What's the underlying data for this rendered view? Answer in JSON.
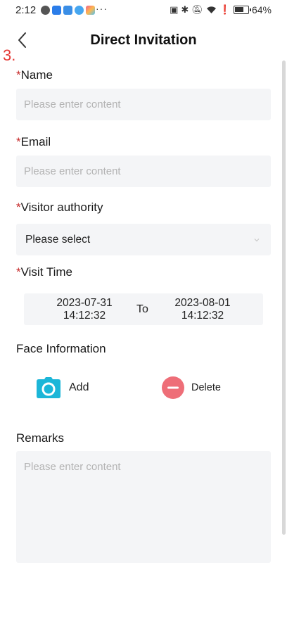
{
  "status_bar": {
    "time": "2:12",
    "more": "···",
    "battery_level": "64%"
  },
  "header": {
    "title": "Direct Invitation",
    "step_mark": "3."
  },
  "form": {
    "required_marker": "*",
    "name": {
      "label": "Name",
      "placeholder": "Please enter content"
    },
    "email": {
      "label": "Email",
      "placeholder": "Please enter content"
    },
    "visitor_authority": {
      "label": "Visitor authority",
      "value": "Please select"
    },
    "visit_time": {
      "label": "Visit Time",
      "start_date": "2023-07-31",
      "start_time": "14:12:32",
      "separator": "To",
      "end_date": "2023-08-01",
      "end_time": "14:12:32"
    },
    "face_information": {
      "label": "Face Information",
      "add_label": "Add",
      "delete_label": "Delete"
    },
    "remarks": {
      "label": "Remarks",
      "placeholder": "Please enter content"
    }
  },
  "colors": {
    "required": "#c62828",
    "step_mark": "#e53935",
    "camera": "#1cb6d8",
    "delete": "#ee6e78",
    "field_bg": "#f4f5f7"
  }
}
